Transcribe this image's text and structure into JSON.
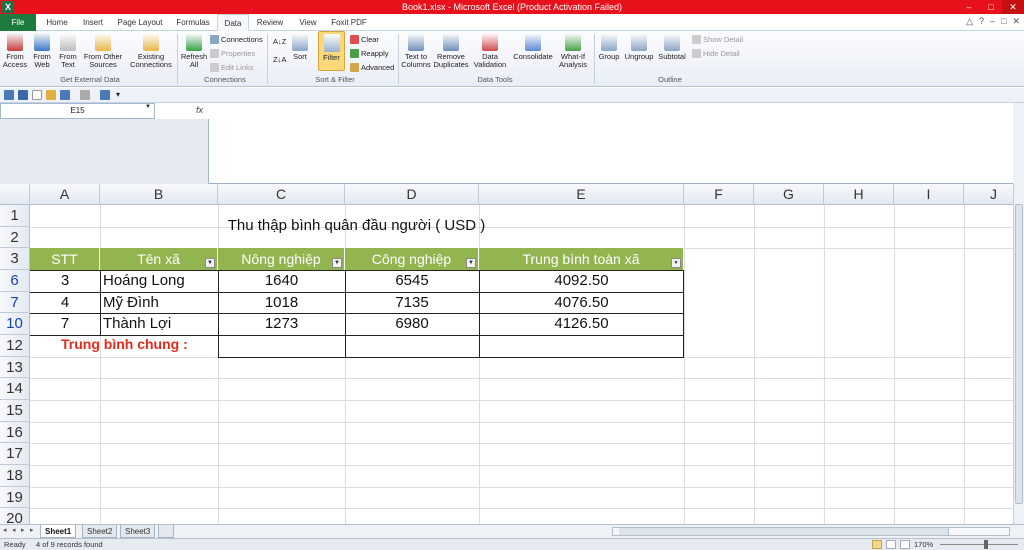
{
  "window": {
    "title": "Book1.xlsx - Microsoft Excel (Product Activation Failed)",
    "app_letter": "X"
  },
  "menu": {
    "tabs": [
      "File",
      "Home",
      "Insert",
      "Page Layout",
      "Formulas",
      "Data",
      "Review",
      "View",
      "Foxit PDF"
    ],
    "active": "Data"
  },
  "ribbon": {
    "get_external": {
      "from_access": "From Access",
      "from_web": "From Web",
      "from_text": "From Text",
      "from_other": "From Other Sources",
      "existing": "Existing Connections",
      "label": "Get External Data"
    },
    "connections": {
      "refresh": "Refresh All",
      "connections": "Connections",
      "properties": "Properties",
      "edit_links": "Edit Links",
      "label": "Connections"
    },
    "sort_filter": {
      "az": "A↓Z",
      "za": "Z↓A",
      "sort": "Sort",
      "filter": "Filter",
      "clear": "Clear",
      "reapply": "Reapply",
      "advanced": "Advanced",
      "label": "Sort & Filter"
    },
    "data_tools": {
      "text_to_columns": "Text to Columns",
      "remove_duplicates": "Remove Duplicates",
      "data_validation": "Data Validation",
      "consolidate": "Consolidate",
      "what_if": "What-If Analysis",
      "label": "Data Tools"
    },
    "outline": {
      "group": "Group",
      "ungroup": "Ungroup",
      "subtotal": "Subtotal",
      "show_detail": "Show Detail",
      "hide_detail": "Hide Detail",
      "label": "Outline"
    }
  },
  "formula_bar": {
    "name_box": "E15",
    "fx": "fx",
    "value": ""
  },
  "columns": [
    "A",
    "B",
    "C",
    "D",
    "E",
    "F",
    "G",
    "H",
    "I",
    "J"
  ],
  "rows": [
    "1",
    "2",
    "3",
    "6",
    "7",
    "10",
    "12",
    "13",
    "14",
    "15",
    "16",
    "17",
    "18",
    "19",
    "20"
  ],
  "sheet_title": "Thu thập bình quân đầu người ( USD )",
  "table": {
    "headers": [
      "STT",
      "Tên xã",
      "Nông nghiệp",
      "Công nghiệp",
      "Trung bình toàn xã"
    ],
    "rows": [
      [
        "3",
        "Hoáng Long",
        "1640",
        "6545",
        "4092.50"
      ],
      [
        "4",
        "Mỹ Đình",
        "1018",
        "7135",
        "4076.50"
      ],
      [
        "7",
        "Thành Lợi",
        "1273",
        "6980",
        "4126.50"
      ]
    ],
    "average_label": "Trung bình chung :"
  },
  "sheet_tabs": [
    "Sheet1",
    "Sheet2",
    "Sheet3"
  ],
  "status": {
    "ready": "Ready",
    "records": "4 of 9 records found",
    "zoom": "170%"
  },
  "colors": {
    "header_fill": "#92b54f",
    "avg_text": "#e82a1a",
    "titlebar": "#e8101a",
    "file_tab": "#1f7a3f"
  }
}
